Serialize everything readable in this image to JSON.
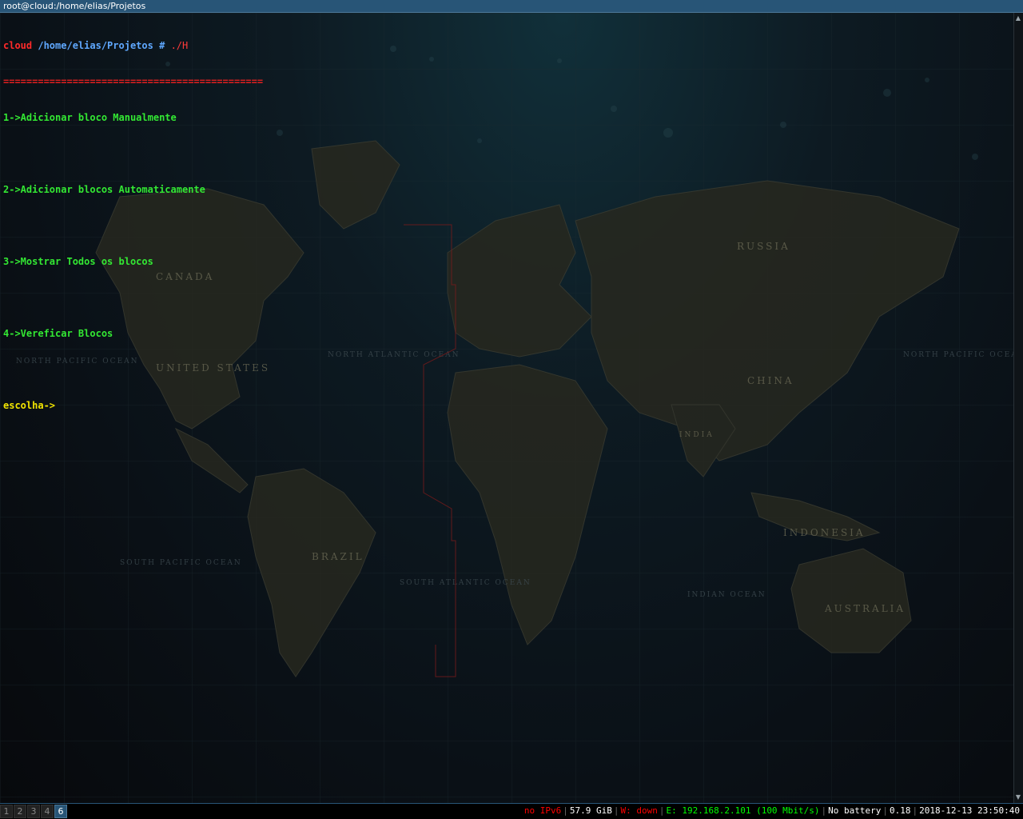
{
  "window": {
    "title": "root@cloud:/home/elias/Projetos"
  },
  "terminal": {
    "prompt_host": "cloud",
    "prompt_path": "/home/elias/Projetos",
    "prompt_symbol": "#",
    "command": "./H",
    "rule": "=============================================",
    "menu_items": [
      "1->Adicionar bloco Manualmente",
      "2->Adicionar blocos Automaticamente",
      "3->Mostrar Todos os blocos",
      "4->Vereficar Blocos"
    ],
    "input_prompt": "escolha->",
    "wallpaper_labels": {
      "canada": "CANADA",
      "usa": "UNITED STATES",
      "russia": "RUSSIA",
      "china": "CHINA",
      "brazil": "BRAZIL",
      "indonesia": "INDONESIA",
      "australia": "AUSTRALIA",
      "india": "INDIA",
      "north_atlantic": "NORTH ATLANTIC OCEAN",
      "south_atlantic": "SOUTH ATLANTIC OCEAN",
      "north_pacific_left": "NORTH PACIFIC OCEAN",
      "north_pacific_right": "NORTH PACIFIC OCEAN",
      "south_pacific": "SOUTH PACIFIC OCEAN",
      "indian_ocean": "INDIAN OCEAN"
    }
  },
  "statusbar": {
    "workspaces": [
      {
        "label": "1",
        "focused": false
      },
      {
        "label": "2",
        "focused": false
      },
      {
        "label": "3",
        "focused": false
      },
      {
        "label": "4",
        "focused": false
      },
      {
        "label": "6",
        "focused": true
      }
    ],
    "ipv6": "no IPv6",
    "disk": "57.9 GiB",
    "wireless": "W: down",
    "ethernet": "E: 192.168.2.101 (100 Mbit/s)",
    "battery": "No battery",
    "load": "0.18",
    "datetime": "2018-12-13 23:50:40"
  },
  "colors": {
    "titlebar": "#285577",
    "host": "#ff2a2a",
    "path": "#5fa8ff",
    "option": "#33e833",
    "prompt": "#f2e400",
    "status_red": "#ff0000",
    "status_green": "#00ff00"
  }
}
